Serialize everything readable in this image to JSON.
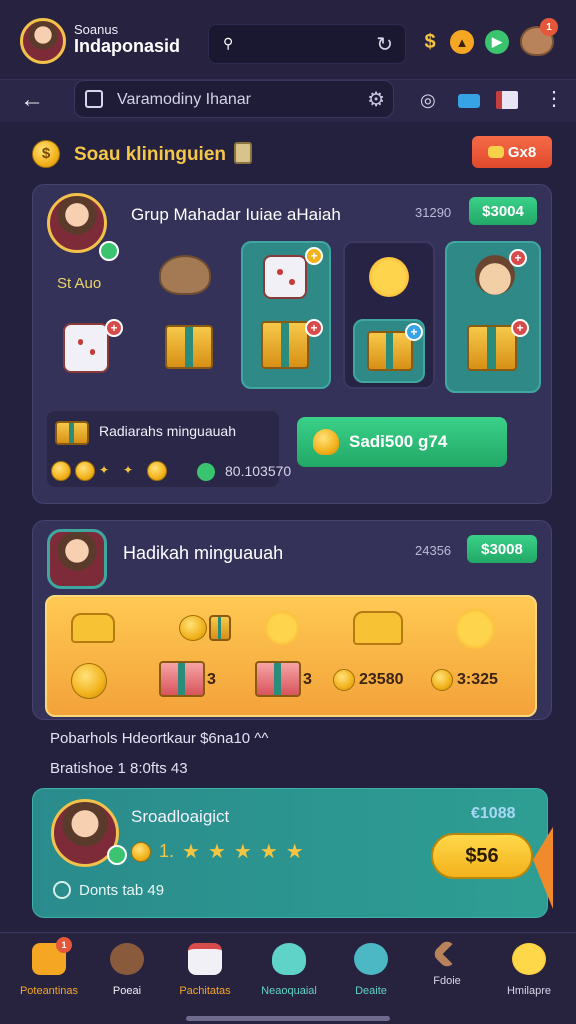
{
  "header": {
    "app_name_line1": "Soanus",
    "app_name_line2": "Indaponasid",
    "search_icon": "search-icon",
    "refresh_icon": "refresh-icon",
    "notification_count": "1"
  },
  "navbar": {
    "search_text": "Varamodiny Ihanar",
    "icons": [
      "back-icon",
      "document-icon",
      "settings-icon",
      "zoom-icon",
      "folder-icon",
      "calendar-icon",
      "more-icon"
    ]
  },
  "section": {
    "title": "Soau klininguien",
    "button_label": "Gx8"
  },
  "card1": {
    "title": "Grup Mahadar Iuiae aHaiah",
    "subtitle": "St Auo",
    "count": "31290",
    "pill": "$3004",
    "bottom_title": "Radiarahs minguauah",
    "bottom_value": "80.103570",
    "claim_label": "Sadi500 g74"
  },
  "card2": {
    "title": "Hadikah minguauah",
    "count": "24356",
    "pill": "$3008",
    "values": [
      "3",
      "3",
      "23580",
      "3:325"
    ]
  },
  "info": {
    "line1": "Pobarhols Hdeortkaur $6na10 ^^",
    "line2": "Bratishoe 1 8:0fts 43"
  },
  "card3": {
    "title": "Sroadloaigict",
    "number": "€1088",
    "star_label": "1.",
    "button_label": "$56",
    "footer": "Donts tab 49"
  },
  "bottom_nav": {
    "items": [
      {
        "label": "Poteantinas",
        "color": "#f5a623",
        "badge": "1"
      },
      {
        "label": "Poeai",
        "color": "#f2f0fb",
        "badge": ""
      },
      {
        "label": "Pachitatas",
        "color": "#f5a623",
        "badge": ""
      },
      {
        "label": "Neaoquaial",
        "color": "#5fd3c7",
        "badge": ""
      },
      {
        "label": "Deaite",
        "color": "#5fd3c7",
        "badge": ""
      },
      {
        "label": "Fdoie",
        "color": "#d8d6ea",
        "badge": ""
      },
      {
        "label": "Hmilapre",
        "color": "#d8d6ea",
        "badge": ""
      }
    ]
  },
  "colors": {
    "background": "#24213f",
    "card": "#35325a",
    "accent_gold": "#f5c648",
    "accent_green": "#2fbf7a",
    "accent_teal": "#2e9e93",
    "accent_orange": "#f3a23a"
  }
}
